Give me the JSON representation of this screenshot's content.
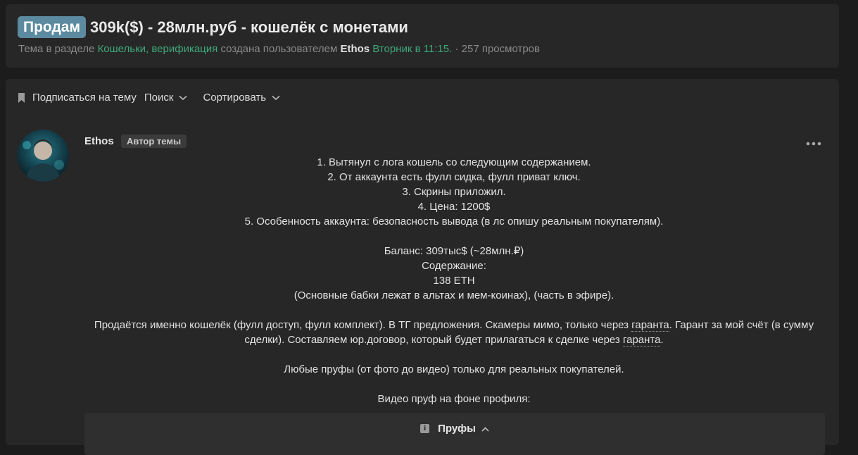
{
  "thread": {
    "prefix": "Продам",
    "title": "309k($) - 28млн.руб - кошелёк с монетами",
    "meta": {
      "section_label": "Тема в разделе",
      "section_link": "Кошельки, верификация",
      "created_by": "создана пользователем",
      "author": "Ethos",
      "date": "Вторник в 11:15.",
      "views": "· 257 просмотров"
    }
  },
  "toolbar": {
    "subscribe": "Подписаться на тему",
    "search": "Поиск",
    "sort": "Сортировать"
  },
  "post": {
    "author": "Ethos",
    "author_badge": "Автор темы",
    "lines": [
      "1. Вытянул с лога кошель со следующим содержанием.",
      "2. От аккаунта есть фулл сидка, фулл приват ключ.",
      "3. Скрины приложил.",
      "4. Цена: 1200$",
      "5. Особенность аккаунта: безопасность вывода (в лс опишу реальным покупателям).",
      "Баланс: 309тыс$ (~28млн.₽)",
      "Содержание:",
      "138 ETH",
      "(Основные бабки лежат в альтах и мем-коинах), (часть в эфире).",
      "Продаётся именно кошелёк (фулл доступ, фулл комплект). В ТГ предложения. Скамеры мимо, только через",
      "гаранта",
      ". Гарант за мой счёт (в сумму",
      "сделки). Составляем юр.договор, который будет прилагаться к сделке через",
      "гаранта",
      ".",
      "Любые пруфы (от фото до видео) только для реальных покупателей.",
      "Видео пруф на фоне профиля:"
    ],
    "spoiler_title": "Пруфы"
  },
  "icons": {
    "bookmark": "bookmark-icon",
    "chevron": "chevron-down-icon",
    "more": "more-horizontal-icon",
    "info": "info-icon",
    "chevron_up": "chevron-up-icon"
  },
  "colors": {
    "accent_green": "#3fa87a",
    "prefix_bg": "#5c8aa0",
    "card_bg": "#272727",
    "page_bg": "#1c1c1c"
  }
}
